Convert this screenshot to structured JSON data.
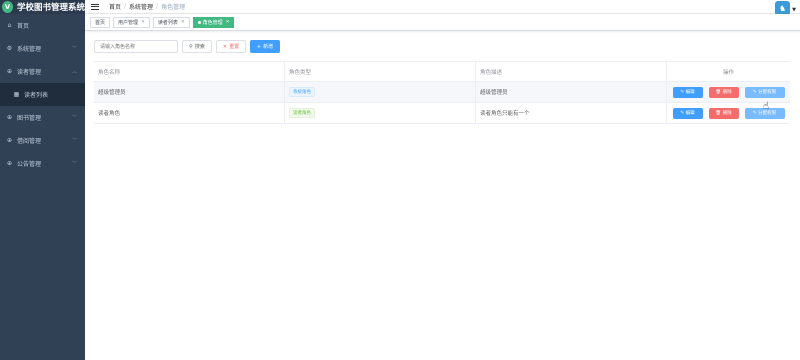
{
  "app": {
    "title": "学校图书管理系统",
    "logo_letter": "V"
  },
  "sidebar": {
    "items": [
      {
        "label": "首页",
        "icon": "home-icon",
        "glyph": "⌂",
        "has_arrow": false
      },
      {
        "label": "系统管理",
        "icon": "gear-icon",
        "glyph": "⚙",
        "has_arrow": true
      },
      {
        "label": "读者管理",
        "icon": "circle-plus-icon",
        "glyph": "⊕",
        "has_arrow": true
      },
      {
        "label": "读者列表",
        "icon": "grid-icon",
        "glyph": "▦",
        "has_arrow": false,
        "sub": true
      },
      {
        "label": "图书管理",
        "icon": "circle-plus-icon",
        "glyph": "⊕",
        "has_arrow": true
      },
      {
        "label": "借阅管理",
        "icon": "circle-plus-icon",
        "glyph": "⊕",
        "has_arrow": true
      },
      {
        "label": "公告管理",
        "icon": "circle-plus-icon",
        "glyph": "⊕",
        "has_arrow": true
      }
    ]
  },
  "breadcrumb": {
    "items": [
      "首页",
      "系统管理",
      "角色管理"
    ],
    "separator": "/"
  },
  "tags": [
    {
      "label": "首页",
      "active": false,
      "closable": false
    },
    {
      "label": "用户管理",
      "active": false,
      "closable": true
    },
    {
      "label": "读者列表",
      "active": false,
      "closable": true
    },
    {
      "label": "角色管理",
      "active": true,
      "closable": true
    }
  ],
  "search": {
    "placeholder": "请输入角色名称",
    "search_label": "搜索",
    "reset_label": "重置",
    "add_label": "新增"
  },
  "table": {
    "headers": [
      "角色名称",
      "角色类型",
      "角色描述",
      "操作"
    ],
    "rows": [
      {
        "name": "超级管理员",
        "type": "系统角色",
        "type_color": "blue",
        "desc": "超级管理员"
      },
      {
        "name": "读者角色",
        "type": "读者角色",
        "type_color": "green",
        "desc": "读者角色只能有一个"
      }
    ],
    "actions": {
      "edit": "编辑",
      "delete": "删除",
      "assign": "分配权限"
    }
  },
  "colors": {
    "sidebar_bg": "#304156",
    "primary": "#409eff",
    "danger": "#f56c6c",
    "success": "#42b983"
  }
}
